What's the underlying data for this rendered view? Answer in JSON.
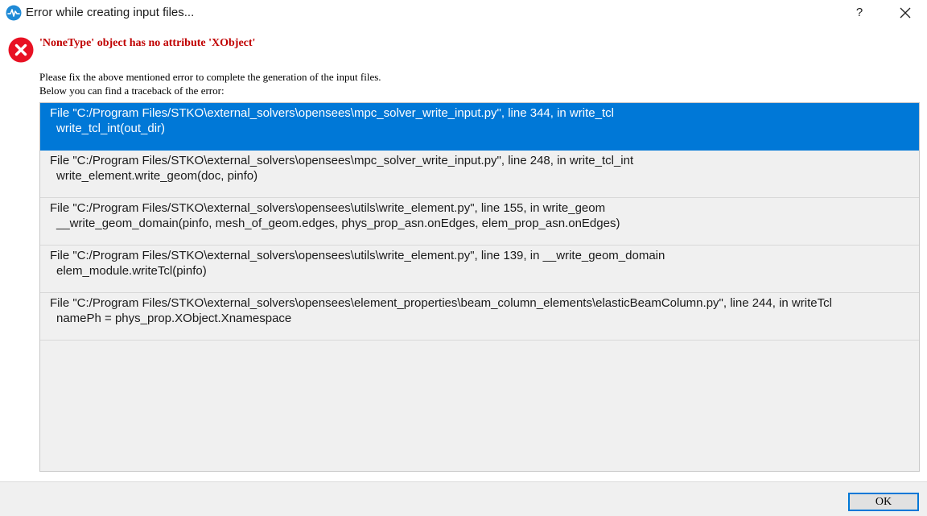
{
  "window": {
    "title": "Error while creating input files...",
    "help_label": "?",
    "icon": "waveform-icon"
  },
  "error": {
    "icon": "error-icon",
    "message": "'NoneType' object has no attribute 'XObject'",
    "info_line_1": "Please fix the above mentioned error to complete the generation of the input files.",
    "info_line_2": "Below you can find a traceback of the error:"
  },
  "traceback": [
    {
      "file": "File \"C:/Program Files/STKO\\external_solvers\\opensees\\mpc_solver_write_input.py\", line 344, in write_tcl",
      "code": "write_tcl_int(out_dir)",
      "selected": true
    },
    {
      "file": "File \"C:/Program Files/STKO\\external_solvers\\opensees\\mpc_solver_write_input.py\", line 248, in write_tcl_int",
      "code": "write_element.write_geom(doc, pinfo)",
      "selected": false
    },
    {
      "file": "File \"C:/Program Files/STKO\\external_solvers\\opensees\\utils\\write_element.py\", line 155, in write_geom",
      "code": "__write_geom_domain(pinfo, mesh_of_geom.edges,  phys_prop_asn.onEdges, elem_prop_asn.onEdges)",
      "selected": false
    },
    {
      "file": "File \"C:/Program Files/STKO\\external_solvers\\opensees\\utils\\write_element.py\", line 139, in __write_geom_domain",
      "code": "elem_module.writeTcl(pinfo)",
      "selected": false
    },
    {
      "file": "File \"C:/Program Files/STKO\\external_solvers\\opensees\\element_properties\\beam_column_elements\\elasticBeamColumn.py\", line 244, in writeTcl",
      "code": "namePh = phys_prop.XObject.Xnamespace",
      "selected": false
    }
  ],
  "footer": {
    "ok_label": "OK"
  },
  "colors": {
    "selection": "#0078d7",
    "error_text": "#c00000",
    "error_icon": "#e81123"
  }
}
